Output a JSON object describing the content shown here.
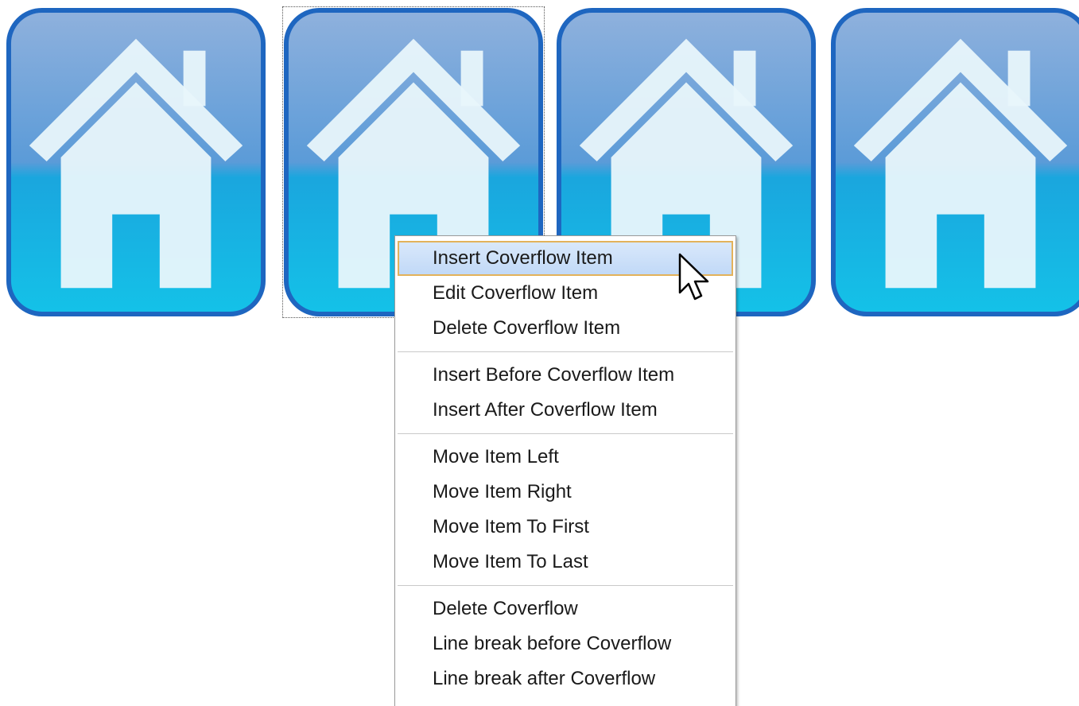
{
  "colors": {
    "icon_top": "#6f9fd8",
    "icon_bottom": "#15b8e3",
    "icon_border": "#1e66c0",
    "house": "#e8f6fb",
    "menu_hover_bg": "#c9ddf8",
    "menu_hover_border": "#e3b25a"
  },
  "coverflow": {
    "items": [
      {
        "icon": "home-icon"
      },
      {
        "icon": "home-icon",
        "selected": true
      },
      {
        "icon": "home-icon"
      },
      {
        "icon": "home-icon"
      }
    ]
  },
  "context_menu": {
    "groups": [
      [
        "Insert Coverflow Item",
        "Edit Coverflow Item",
        "Delete Coverflow Item"
      ],
      [
        "Insert Before Coverflow Item",
        "Insert After Coverflow Item"
      ],
      [
        "Move Item Left",
        "Move Item Right",
        "Move Item To First",
        "Move Item To Last"
      ],
      [
        "Delete Coverflow",
        "Line break before Coverflow",
        "Line break after Coverflow"
      ]
    ],
    "hovered_item": "Insert Coverflow Item"
  },
  "cursor": {
    "icon": "mouse-pointer-icon"
  }
}
